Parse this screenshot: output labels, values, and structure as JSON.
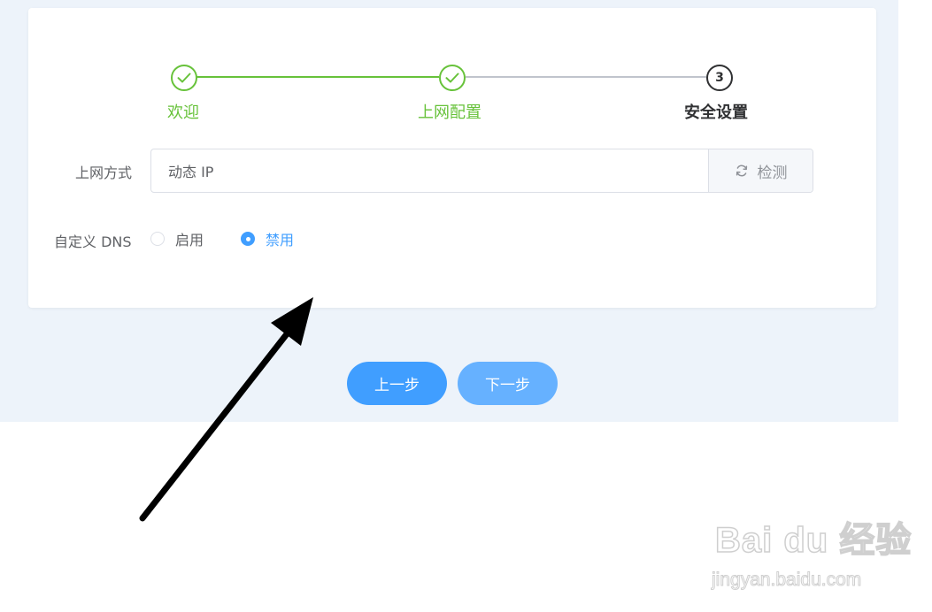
{
  "steps": [
    {
      "title": "欢迎",
      "status": "finished"
    },
    {
      "title": "上网配置",
      "status": "finished"
    },
    {
      "title": "安全设置",
      "status": "current",
      "number": "3"
    }
  ],
  "form": {
    "connection_label": "上网方式",
    "connection_value": "动态 IP",
    "detect_button": "检测",
    "dns_label": "自定义 DNS",
    "dns_options": [
      {
        "label": "启用",
        "checked": false
      },
      {
        "label": "禁用",
        "checked": true
      }
    ]
  },
  "buttons": {
    "prev": "上一步",
    "next": "下一步"
  },
  "watermark": {
    "logo": "Bai du 经验",
    "url": "jingyan.baidu.com"
  },
  "colors": {
    "success": "#67c23a",
    "primary": "#409eff",
    "primary_light": "#66b1ff",
    "background": "#edf3fa"
  }
}
